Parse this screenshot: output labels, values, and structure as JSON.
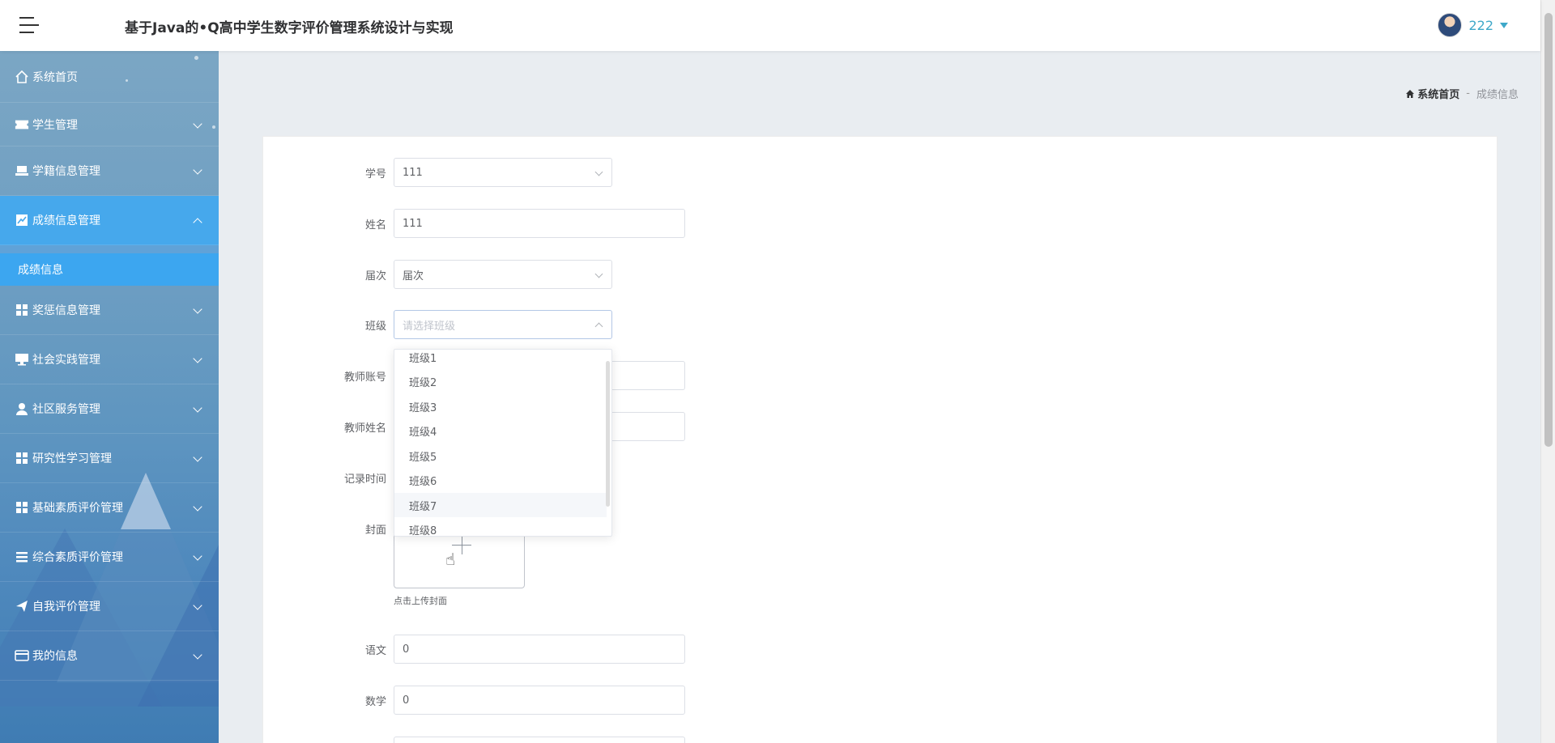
{
  "header": {
    "title": "基于Java的•Q高中学生数字评价管理系统设计与实现",
    "username": "222"
  },
  "sidebar": {
    "items": [
      {
        "label": "系统首页",
        "icon": "home-icon"
      },
      {
        "label": "学生管理",
        "icon": "ticket-icon"
      },
      {
        "label": "学籍信息管理",
        "icon": "laptop-icon"
      },
      {
        "label": "成绩信息管理",
        "icon": "chart-icon",
        "active": true
      },
      {
        "label": "奖惩信息管理",
        "icon": "grid-icon"
      },
      {
        "label": "社会实践管理",
        "icon": "monitor-icon"
      },
      {
        "label": "社区服务管理",
        "icon": "user-icon"
      },
      {
        "label": "研究性学习管理",
        "icon": "grid-icon"
      },
      {
        "label": "基础素质评价管理",
        "icon": "grid-icon"
      },
      {
        "label": "综合素质评价管理",
        "icon": "list-icon"
      },
      {
        "label": "自我评价管理",
        "icon": "send-icon"
      },
      {
        "label": "我的信息",
        "icon": "card-icon"
      }
    ],
    "submenu_label": "成绩信息"
  },
  "breadcrumb": {
    "home": "系统首页",
    "separator": "-",
    "current": "成绩信息"
  },
  "form": {
    "student_id": {
      "label": "学号",
      "value": "111"
    },
    "name": {
      "label": "姓名",
      "value": "111"
    },
    "grade": {
      "label": "届次",
      "value": "届次"
    },
    "class": {
      "label": "班级",
      "placeholder": "请选择班级"
    },
    "teacher_account": {
      "label": "教师账号"
    },
    "teacher_name": {
      "label": "教师姓名"
    },
    "record_time": {
      "label": "记录时间"
    },
    "cover": {
      "label": "封面",
      "tip": "点击上传封面"
    },
    "chinese": {
      "label": "语文",
      "value": "0"
    },
    "math": {
      "label": "数学",
      "value": "0"
    }
  },
  "dropdown": {
    "options": [
      "班级1",
      "班级2",
      "班级3",
      "班级4",
      "班级5",
      "班级6",
      "班级7",
      "班级8"
    ],
    "hovered": "班级7"
  },
  "colors": {
    "accent": "#46a8ec",
    "username": "#3ea8c9"
  }
}
